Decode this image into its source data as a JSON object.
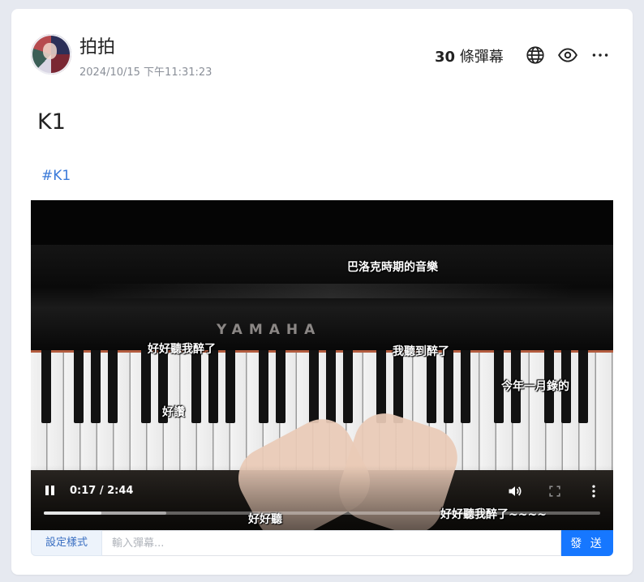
{
  "post": {
    "username": "拍拍",
    "timestamp": "2024/10/15 下午11:31:23",
    "danmaku_count": "30",
    "danmaku_count_suffix": " 條彈幕",
    "title": "K1",
    "hashtag": "#K1"
  },
  "header_actions": [
    "globe-icon",
    "eye-icon",
    "more-icon"
  ],
  "video": {
    "brand_text": "YAMAHA",
    "current_time": "0:17",
    "duration": "2:44",
    "time_display": "0:17 / 2:44",
    "progress_fraction": 0.104,
    "buffered_fraction": 0.22,
    "controls": [
      "pause-icon",
      "volume-icon",
      "fullscreen-icon",
      "more-options-icon"
    ]
  },
  "danmaku": [
    {
      "text": "巴洛克時期的音樂"
    },
    {
      "text": "好好聽我醉了"
    },
    {
      "text": "我聽到醉了"
    },
    {
      "text": "今年一月錄的"
    },
    {
      "text": "好讚"
    },
    {
      "text": "好好聽"
    },
    {
      "text": "好好聽我醉了~~~~"
    }
  ],
  "composer": {
    "style_button": "設定樣式",
    "input_placeholder": "輸入彈幕...",
    "input_value": "",
    "send_button": "發 送"
  },
  "colors": {
    "accent": "#1677ff",
    "hashtag": "#3a7ad9",
    "background": "#e6e9f0"
  }
}
